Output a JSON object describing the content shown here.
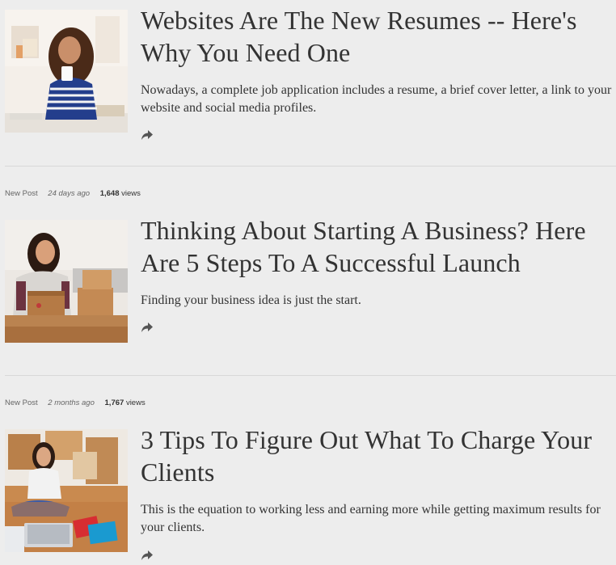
{
  "posts": [
    {
      "title": "Websites Are The New Resumes -- Here's Why You Need One",
      "excerpt": "Nowadays, a complete job application includes a resume, a brief cover letter, a link to your website and social media profiles.",
      "share_icon": "share-arrow-icon"
    },
    {
      "meta": {
        "type": "New Post",
        "age": "24 days ago",
        "views_count": "1,648",
        "views_label": "views"
      },
      "title": "Thinking About Starting A Business? Here Are 5 Steps To A Successful Launch",
      "excerpt": "Finding your business idea is just the start.",
      "share_icon": "share-arrow-icon"
    },
    {
      "meta": {
        "type": "New Post",
        "age": "2 months ago",
        "views_count": "1,767",
        "views_label": "views"
      },
      "title": "3 Tips To Figure Out What To Charge Your Clients",
      "excerpt": "This is the equation to working less and earning more while getting maximum results for your clients.",
      "share_icon": "share-arrow-icon"
    }
  ]
}
